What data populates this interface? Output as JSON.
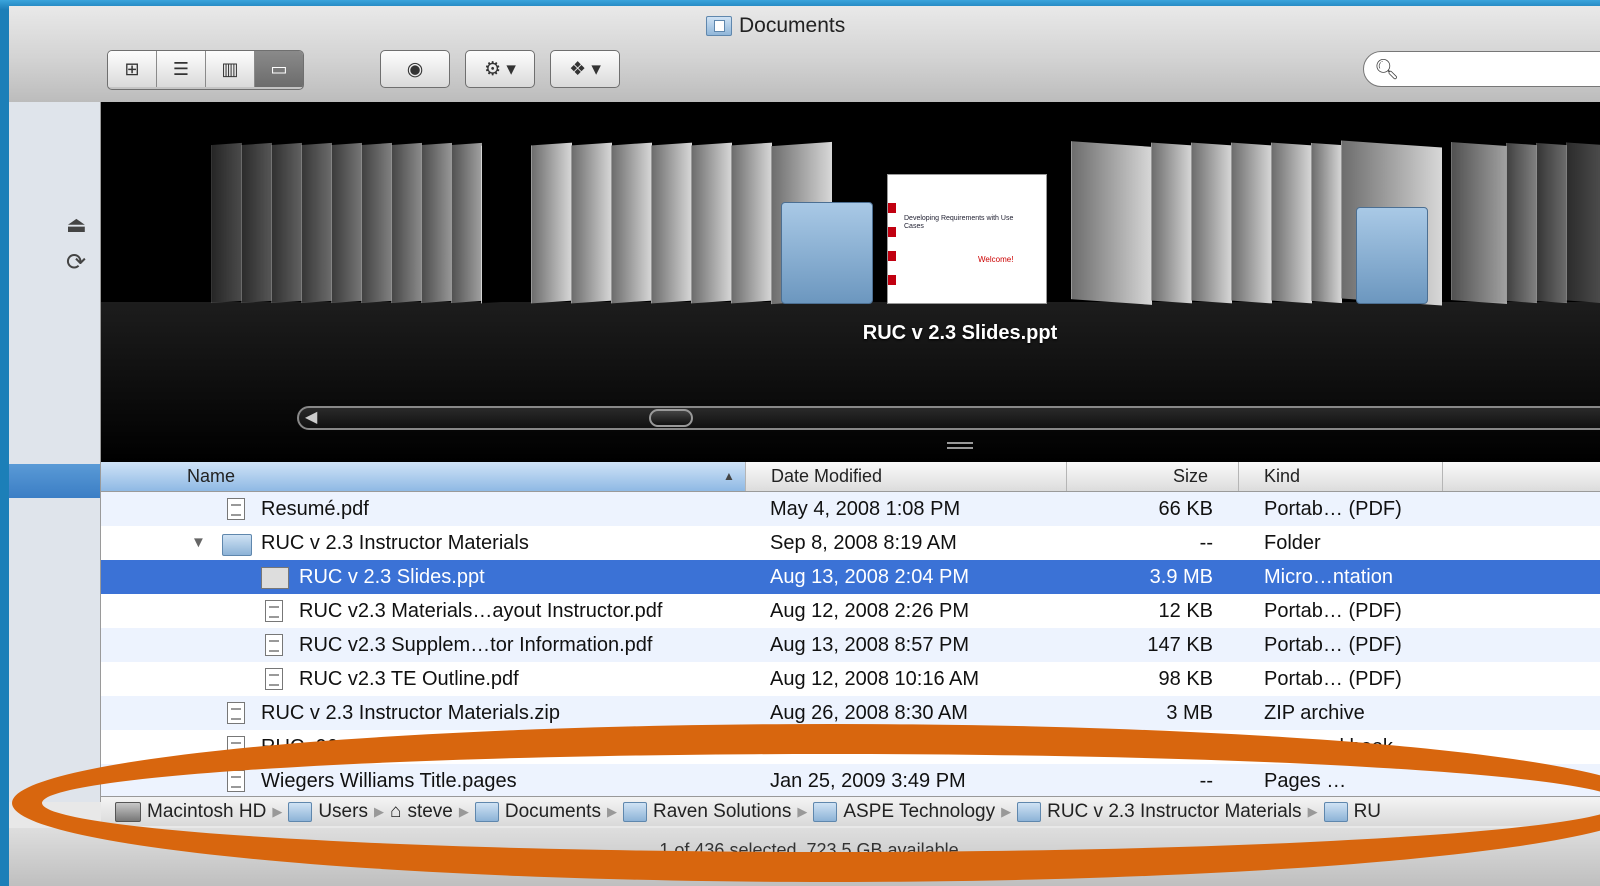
{
  "window": {
    "title": "Documents"
  },
  "toolbar": {
    "view_buttons": [
      "icon-view",
      "list-view",
      "column-view",
      "cover-flow-view"
    ],
    "quicklook_label": "◉",
    "action_label": "⚙ ▾",
    "dropbox_label": "❖ ▾",
    "search_placeholder": ""
  },
  "coverflow": {
    "selected_caption": "RUC v 2.3 Slides.ppt",
    "slide_title": "Developing Requirements with Use Cases",
    "slide_welcome": "Welcome!"
  },
  "list": {
    "columns": {
      "name": "Name",
      "date": "Date Modified",
      "size": "Size",
      "kind": "Kind"
    },
    "rows": [
      {
        "name": "Resumé.pdf",
        "date": "May 4, 2008 1:08 PM",
        "size": "66 KB",
        "kind": "Portab… (PDF)"
      },
      {
        "name": "RUC v 2.3 Instructor Materials",
        "date": "Sep 8, 2008 8:19 AM",
        "size": "--",
        "kind": "Folder"
      },
      {
        "name": "RUC v 2.3 Slides.ppt",
        "date": "Aug 13, 2008 2:04 PM",
        "size": "3.9 MB",
        "kind": "Micro…ntation"
      },
      {
        "name": "RUC v2.3 Materials…ayout Instructor.pdf",
        "date": "Aug 12, 2008 2:26 PM",
        "size": "12 KB",
        "kind": "Portab… (PDF)"
      },
      {
        "name": "RUC v2.3 Supplem…tor Information.pdf",
        "date": "Aug 13, 2008 8:57 PM",
        "size": "147 KB",
        "kind": "Portab… (PDF)"
      },
      {
        "name": "RUC v2.3 TE Outline.pdf",
        "date": "Aug 12, 2008 10:16 AM",
        "size": "98 KB",
        "kind": "Portab… (PDF)"
      },
      {
        "name": "RUC v 2.3 Instructor Materials.zip",
        "date": "Aug 26, 2008 8:30 AM",
        "size": "3 MB",
        "kind": "ZIP archive"
      },
      {
        "name": "RUC_06_11_08",
        "date": "",
        "size": "",
        "kind": "Micro…rkbook"
      },
      {
        "name": "Wiegers Williams Title.pages",
        "date": "Jan 25, 2009 3:49 PM",
        "size": "--",
        "kind": "Pages …"
      }
    ]
  },
  "pathbar": {
    "items": [
      "Macintosh HD",
      "Users",
      "steve",
      "Documents",
      "Raven Solutions",
      "ASPE Technology",
      "RUC v 2.3 Instructor Materials",
      "RU"
    ]
  },
  "status": {
    "text": "1 of 436 selected, 723.5 GB available"
  },
  "colors": {
    "selection": "#3b72d6",
    "highlight": "#d8660e",
    "desktop": "#1c7fb8"
  }
}
